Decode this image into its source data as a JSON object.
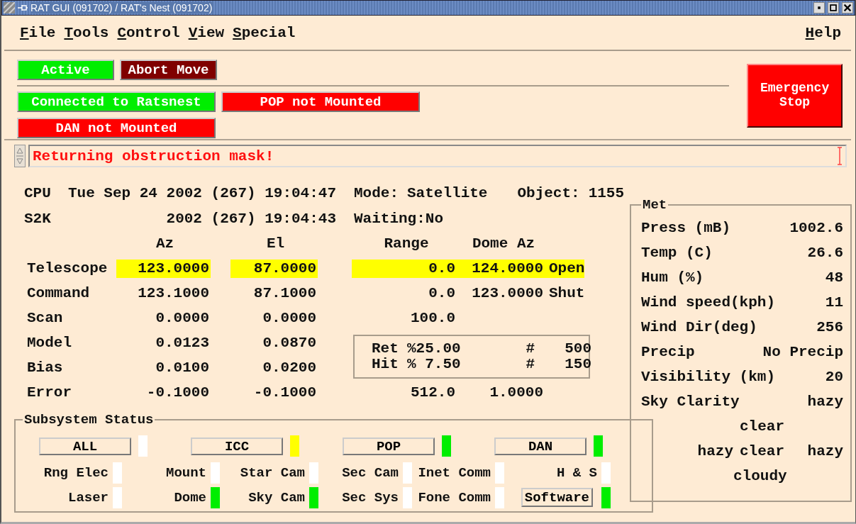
{
  "window": {
    "title": "RAT GUI (091702) / RAT's Nest (091702)"
  },
  "menu": [
    "File",
    "Tools",
    "Control",
    "View",
    "Special"
  ],
  "help_menu": "Help",
  "status_rows": [
    [
      {
        "label": "Active",
        "color": "#00ee00"
      },
      {
        "label": "Abort Move",
        "color": "#800000"
      }
    ],
    [
      {
        "label": "Connected to Ratsnest",
        "color": "#00ee00"
      },
      {
        "label": "POP not Mounted",
        "color": "#ff0000"
      }
    ],
    [
      {
        "label": "DAN not Mounted",
        "color": "#ff0000"
      }
    ]
  ],
  "emergency_button": "Emergency Stop",
  "message": "Returning obstruction mask!",
  "clock": [
    {
      "label": "CPU",
      "value": "Tue Sep 24 2002 (267) 19:04:47"
    },
    {
      "label": "S2K",
      "value": "2002 (267) 19:04:43"
    }
  ],
  "mode": {
    "label": "Mode:",
    "value": "Satellite"
  },
  "object": {
    "label": "Object:",
    "value": "1155"
  },
  "waiting": {
    "label": "Waiting:",
    "value": "No"
  },
  "table": {
    "columns": [
      "Az",
      "El",
      "Range",
      "Dome Az"
    ],
    "rows": [
      {
        "label": "Telescope",
        "az": "123.0000",
        "el": "87.0000",
        "range": "0.0",
        "dome_az": "124.0000",
        "dome": "Open",
        "highlighted": true
      },
      {
        "label": "Command",
        "az": "123.1000",
        "el": "87.1000",
        "range": "0.0",
        "dome_az": "123.0000",
        "dome": "Shut",
        "highlighted": false
      },
      {
        "label": "Scan",
        "az": "0.0000",
        "el": "0.0000",
        "range": "100.0",
        "highlighted": false
      },
      {
        "label": "Model",
        "az": "0.0123",
        "el": "0.0870",
        "highlighted": false
      },
      {
        "label": "Bias",
        "az": "0.0100",
        "el": "0.0200",
        "highlighted": false
      },
      {
        "label": "Error",
        "az": "-0.1000",
        "el": "-0.1000",
        "range": "512.0",
        "dome_az": "1.0000",
        "highlighted": false
      }
    ]
  },
  "ret_hit": [
    {
      "label": "Ret",
      "value": "%25.00",
      "count_label": "#",
      "count": "500"
    },
    {
      "label": "Hit",
      "value": "% 7.50",
      "count_label": "#",
      "count": "150"
    }
  ],
  "met": {
    "title": "Met",
    "rows": [
      {
        "label": "Press (mB)",
        "value": "1002.6"
      },
      {
        "label": "Temp (C)",
        "value": "26.6"
      },
      {
        "label": "Hum (%)",
        "value": "48"
      },
      {
        "label": "Wind speed(kph)",
        "value": "11"
      },
      {
        "label": "Wind Dir(deg)",
        "value": "256"
      },
      {
        "label": "Precip",
        "value": "No Precip"
      },
      {
        "label": "Visibility (km)",
        "value": "20"
      }
    ],
    "sky_clarity": {
      "label": "Sky Clarity",
      "rows": [
        {
          "right": "hazy"
        },
        {
          "middle": "clear"
        },
        {
          "left": "hazy",
          "middle": "clear",
          "right": "hazy"
        },
        {
          "middle": "cloudy"
        }
      ]
    }
  },
  "subsystems": {
    "title": "Subsystem Status",
    "groups": [
      {
        "label": "ALL",
        "color": "#ffffff"
      },
      {
        "label": "ICC",
        "color": "#ffff00"
      },
      {
        "label": "POP",
        "color": "#00ee00"
      },
      {
        "label": "DAN",
        "color": "#00ee00"
      }
    ],
    "items": [
      {
        "label": "Rng Elec",
        "color": "#ffffff",
        "kind": "label"
      },
      {
        "label": "Mount",
        "color": "#ffffff",
        "kind": "label"
      },
      {
        "label": "Star Cam",
        "color": "#ffffff",
        "kind": "label"
      },
      {
        "label": "Sec Cam",
        "color": "#ffffff",
        "kind": "label"
      },
      {
        "label": "Inet Comm",
        "color": "#ffffff",
        "kind": "label"
      },
      {
        "label": "H & S",
        "color": "#ffffff",
        "kind": "label"
      },
      {
        "label": "Laser",
        "color": "#ffffff",
        "kind": "label"
      },
      {
        "label": "Dome",
        "color": "#00ee00",
        "kind": "label"
      },
      {
        "label": "Sky Cam",
        "color": "#00ee00",
        "kind": "label"
      },
      {
        "label": "Sec Sys",
        "color": "#ffffff",
        "kind": "label"
      },
      {
        "label": "Fone Comm",
        "color": "#ffffff",
        "kind": "label"
      },
      {
        "label": "Software",
        "color": "#00ee00",
        "kind": "button"
      }
    ]
  }
}
